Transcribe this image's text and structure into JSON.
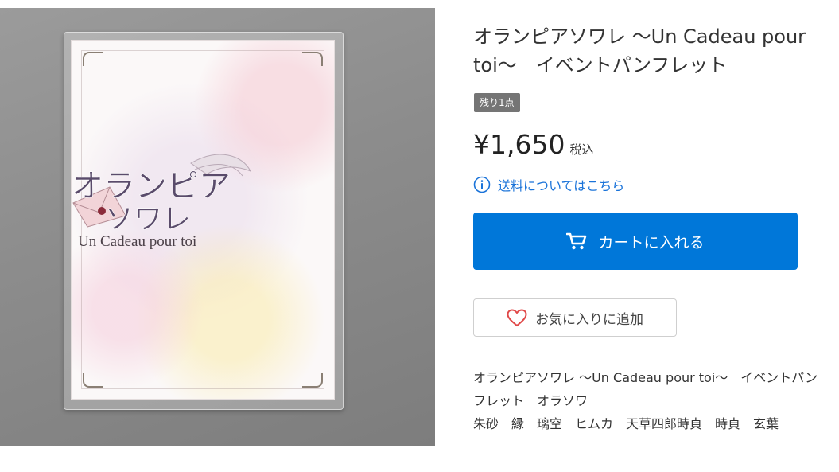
{
  "product": {
    "title": "オランピアソワレ ～Un Cadeau pour toi～　イベントパンフレット",
    "stock_badge": "残り1点",
    "price": "¥1,650",
    "tax_note": "税込",
    "shipping_link": "送料についてはこちら",
    "add_to_cart": "カートに入れる",
    "add_to_favorites": "お気に入りに追加",
    "description_lines": [
      "オランピアソワレ ～Un Cadeau pour toi～　イベントパン",
      "フレット　オラソワ",
      "朱砂　縁　璃空　ヒムカ　天草四郎時貞　時貞　玄葉"
    ]
  },
  "photo": {
    "logo_text_line1": "オランピア",
    "logo_text_line2": "ソワレ",
    "logo_subtitle": "Un Cadeau pour toi"
  },
  "colors": {
    "accent": "#0077d9",
    "link": "#1a73d9",
    "badge": "#757575",
    "heart": "#e04848"
  },
  "icons": {
    "info": "info-circle-icon",
    "cart": "cart-icon",
    "heart": "heart-outline-icon"
  }
}
